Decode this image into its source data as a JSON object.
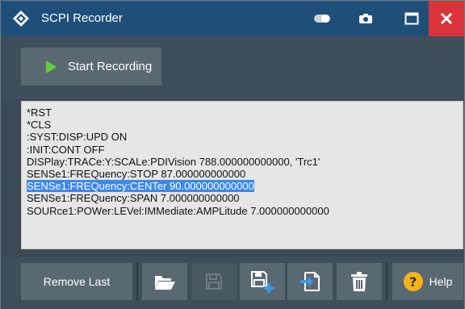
{
  "window": {
    "title": "SCPI Recorder"
  },
  "toolbar": {
    "start_label": "Start Recording"
  },
  "log": {
    "lines": [
      "*RST",
      "*CLS",
      ":SYST:DISP:UPD ON",
      ":INIT:CONT OFF",
      "DISPlay:TRACe:Y:SCALe:PDIVision 788.000000000000, 'Trc1'",
      "SENSe1:FREQuency:STOP 87.000000000000",
      "SENSe1:FREQuency:CENTer 90.000000000000",
      "SENSe1:FREQuency:SPAN 7.000000000000",
      "SOURce1:POWer:LEVel:IMMediate:AMPLitude 7.000000000000"
    ],
    "selected_line": "SENSe1:FREQuency:CENTer 90.000000000000"
  },
  "footer": {
    "remove_label": "Remove Last",
    "help_label": "Help",
    "help_glyph": "?"
  },
  "icons": [
    "logo-icon",
    "toggle-icon",
    "camera-icon",
    "maximize-icon",
    "close-icon",
    "play-icon",
    "open-folder-icon",
    "save-icon",
    "save-as-icon",
    "export-icon",
    "trash-icon",
    "help-icon"
  ],
  "colors": {
    "titlebar": "#1f4f78",
    "close": "#d8343a",
    "panel": "#3f4e59",
    "button": "#5a6872",
    "play": "#5ed13a",
    "selection": "#3b87f0",
    "help": "#f2b518"
  }
}
